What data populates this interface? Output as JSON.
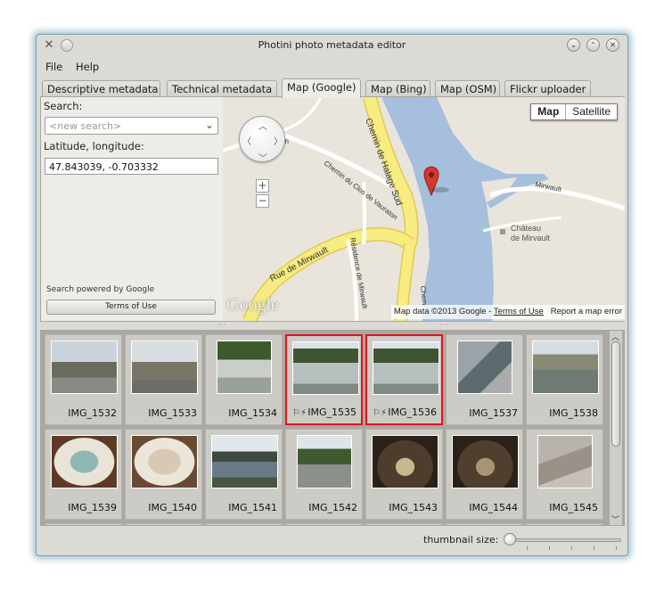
{
  "window": {
    "title": "Photini photo metadata editor"
  },
  "menu": {
    "file": "File",
    "help": "Help"
  },
  "tabs": [
    {
      "label": "Descriptive metadata",
      "active": false
    },
    {
      "label": "Technical metadata",
      "active": false
    },
    {
      "label": "Map (Google)",
      "active": true
    },
    {
      "label": "Map (Bing)",
      "active": false
    },
    {
      "label": "Map (OSM)",
      "active": false
    },
    {
      "label": "Flickr uploader",
      "active": false
    }
  ],
  "map_panel": {
    "search_label": "Search:",
    "search_placeholder": "<new search>",
    "latlng_label": "Latitude, longitude:",
    "latlng_value": "47.843039, -0.703332",
    "powered_by": "Search powered by Google",
    "terms_button": "Terms of Use"
  },
  "map": {
    "type_map": "Map",
    "type_satellite": "Satellite",
    "logo": "Google",
    "attribution": "Map data ©2013 Google",
    "terms_link": "Terms of Use",
    "report": "Report a map error",
    "labels": {
      "chemin_halage": "Chemin de Halage Sud",
      "chemin_clos": "Chemin du Clos de Vauraton",
      "rue_mirwault": "Rue de Mirwault",
      "residence": "Résidence de Mirwault",
      "mirwault": "Mirwault",
      "chateau_1": "Château",
      "chateau_2": "de Mirvault",
      "on": "on",
      "chem": "Chem"
    },
    "zoom_in": "+",
    "zoom_out": "−"
  },
  "thumbnails": [
    {
      "name": "IMG_1532",
      "selected": false,
      "flags": ""
    },
    {
      "name": "IMG_1533",
      "selected": false,
      "flags": ""
    },
    {
      "name": "IMG_1534",
      "selected": false,
      "flags": ""
    },
    {
      "name": "IMG_1535",
      "selected": true,
      "flags": "⚐⚡"
    },
    {
      "name": "IMG_1536",
      "selected": true,
      "flags": "⚐⚡"
    },
    {
      "name": "IMG_1537",
      "selected": false,
      "flags": ""
    },
    {
      "name": "IMG_1538",
      "selected": false,
      "flags": ""
    },
    {
      "name": "IMG_1539",
      "selected": false,
      "flags": ""
    },
    {
      "name": "IMG_1540",
      "selected": false,
      "flags": ""
    },
    {
      "name": "IMG_1541",
      "selected": false,
      "flags": ""
    },
    {
      "name": "IMG_1542",
      "selected": false,
      "flags": ""
    },
    {
      "name": "IMG_1543",
      "selected": false,
      "flags": ""
    },
    {
      "name": "IMG_1544",
      "selected": false,
      "flags": ""
    },
    {
      "name": "IMG_1545",
      "selected": false,
      "flags": ""
    }
  ],
  "thumbnail_size_label": "thumbnail size:",
  "colors": {
    "selection": "#e3141b",
    "river": "#a5bfdd",
    "road": "#f7ec81",
    "marker": "#d33a2c"
  },
  "icons": {
    "app": "tools-icon",
    "pin": "pin-icon",
    "minimize": "minimize-icon",
    "maximize": "maximize-icon",
    "close": "close-icon"
  }
}
